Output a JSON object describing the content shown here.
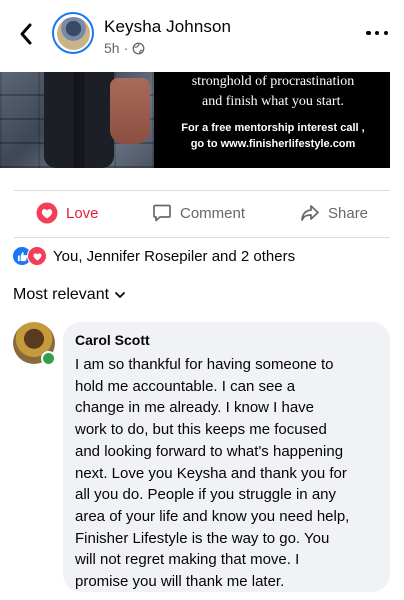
{
  "header": {
    "author_name": "Keysha Johnson",
    "time": "5h",
    "privacy_icon": "globe-icon"
  },
  "post_image": {
    "line1": "stronghold of procrastination",
    "line2": "and finish what you start.",
    "line3": "For a free mentorship interest call ,",
    "line4": "go to www.finisherlifestyle.com"
  },
  "actions": {
    "love_label": "Love",
    "comment_label": "Comment",
    "share_label": "Share"
  },
  "reactions": {
    "summary": "You, Jennifer Rosepiler and 2 others",
    "types": [
      "like",
      "love"
    ]
  },
  "comments_sort": {
    "label": "Most relevant"
  },
  "comment": {
    "author": "Carol Scott",
    "text": "I am so thankful for having someone to\nhold me accountable.  I can see a\nchange in me already.  I know I have\nwork to do, but this keeps me focused\nand looking forward to what's happening\nnext.  Love you Keysha and thank you for\nall you do.  People if you struggle in any\narea of your life and know you need help,\nFinisher Lifestyle is the way to go.  You\nwill not regret making that move.  I\npromise you will thank me later."
  },
  "colors": {
    "accent_blue": "#1877f2",
    "love_red": "#e41e3f",
    "online_green": "#31a24c",
    "bubble_bg": "#f0f2f5",
    "secondary_text": "#65676b"
  }
}
